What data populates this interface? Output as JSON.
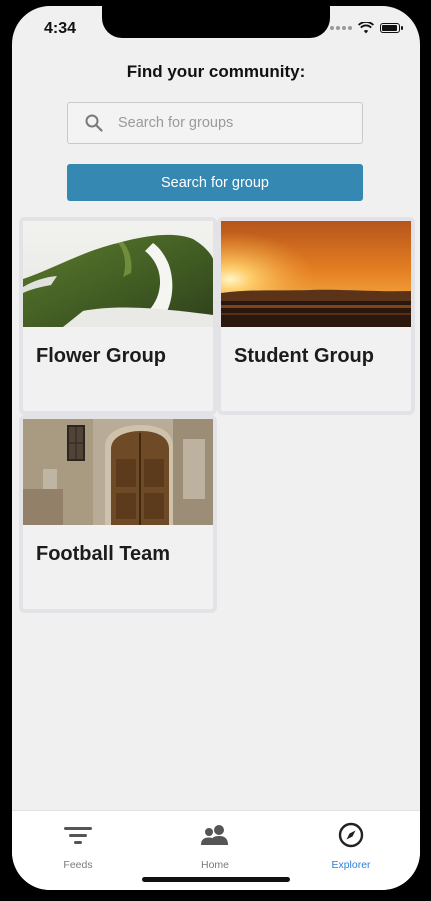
{
  "status_bar": {
    "time": "4:34"
  },
  "page": {
    "title": "Find your community:"
  },
  "search": {
    "placeholder": "Search for groups",
    "value": ""
  },
  "search_button": {
    "label": "Search for group"
  },
  "groups": [
    {
      "name": "Flower Group"
    },
    {
      "name": "Student Group"
    },
    {
      "name": "Football Team"
    }
  ],
  "tabbar": {
    "active": "Explorer",
    "tabs": [
      {
        "label": "Feeds",
        "icon": "filter-lines-icon"
      },
      {
        "label": "Home",
        "icon": "people-icon"
      },
      {
        "label": "Explorer",
        "icon": "compass-icon"
      }
    ]
  },
  "colors": {
    "accent": "#3488b1",
    "active_tab": "#2f7fd9",
    "background": "#f0f0f0"
  }
}
